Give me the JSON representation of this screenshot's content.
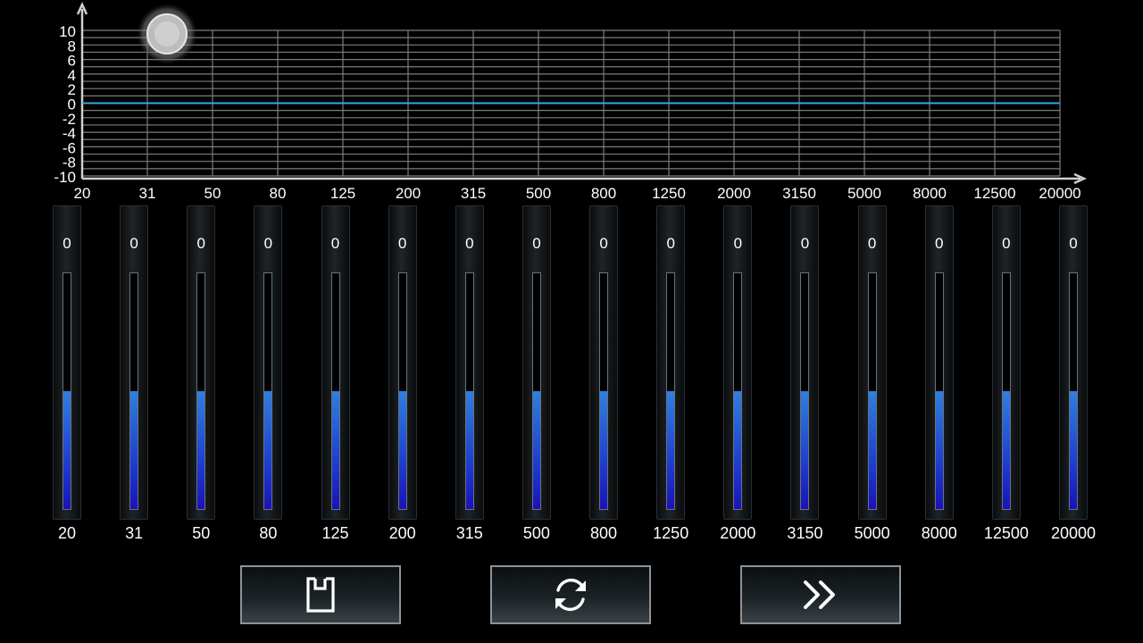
{
  "graph": {
    "y_ticks": [
      "10",
      "8",
      "6",
      "4",
      "2",
      "0",
      "-2",
      "-4",
      "-6",
      "-8",
      "-10"
    ],
    "x_ticks": [
      "20",
      "31",
      "50",
      "80",
      "125",
      "200",
      "315",
      "500",
      "800",
      "1250",
      "2000",
      "3150",
      "5000",
      "8000",
      "12500",
      "20000"
    ]
  },
  "bands": [
    {
      "freq": "20",
      "value": "0"
    },
    {
      "freq": "31",
      "value": "0"
    },
    {
      "freq": "50",
      "value": "0"
    },
    {
      "freq": "80",
      "value": "0"
    },
    {
      "freq": "125",
      "value": "0"
    },
    {
      "freq": "200",
      "value": "0"
    },
    {
      "freq": "315",
      "value": "0"
    },
    {
      "freq": "500",
      "value": "0"
    },
    {
      "freq": "800",
      "value": "0"
    },
    {
      "freq": "1250",
      "value": "0"
    },
    {
      "freq": "2000",
      "value": "0"
    },
    {
      "freq": "3150",
      "value": "0"
    },
    {
      "freq": "5000",
      "value": "0"
    },
    {
      "freq": "8000",
      "value": "0"
    },
    {
      "freq": "12500",
      "value": "0"
    },
    {
      "freq": "20000",
      "value": "0"
    }
  ],
  "buttons": {
    "save_icon": "save-icon",
    "reset_icon": "refresh-icon",
    "next_icon": "double-chevron-right-icon"
  },
  "colors": {
    "curve": "#3aa6e0",
    "grid": "#7d7d7d",
    "fill_top": "#2f7fe0",
    "fill_bottom": "#1a12b8"
  }
}
